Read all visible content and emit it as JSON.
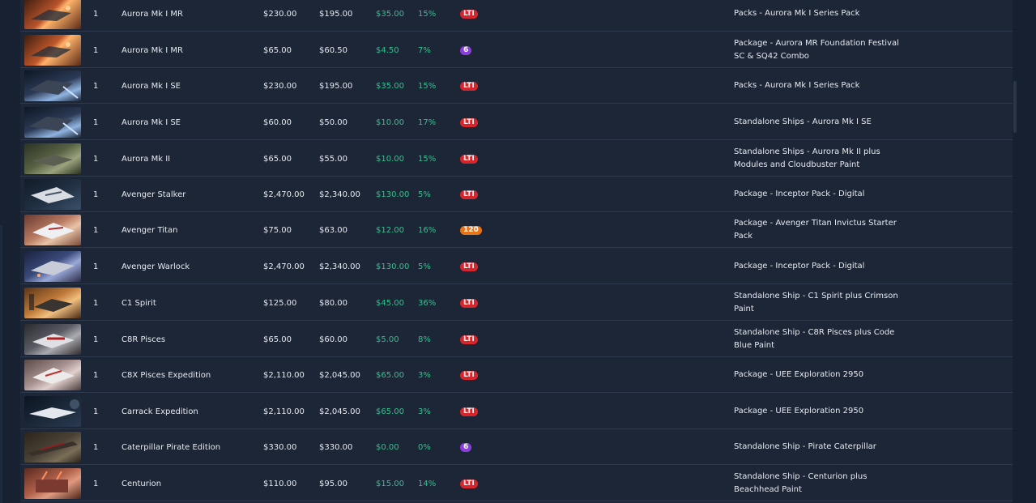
{
  "colors": {
    "background": "#172030",
    "panel": "#1d2636",
    "divider": "#2d3a4e",
    "savings_green": "#2fc28e",
    "badge_lti": "#d6262d",
    "badge_6": "#8a3fd8",
    "badge_120": "#e8741a"
  },
  "rows": [
    {
      "qty": "1",
      "name": "Aurora Mk I MR",
      "price": "$230.00",
      "paid": "$195.00",
      "savings": "$35.00",
      "percent": "15%",
      "insurance": "LTI",
      "package": "Packs - Aurora Mk I Series Pack",
      "thumb": "aurora-mr"
    },
    {
      "qty": "1",
      "name": "Aurora Mk I MR",
      "price": "$65.00",
      "paid": "$60.50",
      "savings": "$4.50",
      "percent": "7%",
      "insurance": "6",
      "package": "Package - Aurora MR Foundation Festival SC & SQ42 Combo",
      "thumb": "aurora-mr"
    },
    {
      "qty": "1",
      "name": "Aurora Mk I SE",
      "price": "$230.00",
      "paid": "$195.00",
      "savings": "$35.00",
      "percent": "15%",
      "insurance": "LTI",
      "package": "Packs - Aurora Mk I Series Pack",
      "thumb": "aurora-se"
    },
    {
      "qty": "1",
      "name": "Aurora Mk I SE",
      "price": "$60.00",
      "paid": "$50.00",
      "savings": "$10.00",
      "percent": "17%",
      "insurance": "LTI",
      "package": "Standalone Ships - Aurora Mk I SE",
      "thumb": "aurora-se"
    },
    {
      "qty": "1",
      "name": "Aurora Mk II",
      "price": "$65.00",
      "paid": "$55.00",
      "savings": "$10.00",
      "percent": "15%",
      "insurance": "LTI",
      "package": "Standalone Ships - Aurora Mk II plus Modules and Cloudbuster Paint",
      "thumb": "aurora-mk2"
    },
    {
      "qty": "1",
      "name": "Avenger Stalker",
      "price": "$2,470.00",
      "paid": "$2,340.00",
      "savings": "$130.00",
      "percent": "5%",
      "insurance": "LTI",
      "package": "Package - Inceptor Pack - Digital",
      "thumb": "avenger-stalker"
    },
    {
      "qty": "1",
      "name": "Avenger Titan",
      "price": "$75.00",
      "paid": "$63.00",
      "savings": "$12.00",
      "percent": "16%",
      "insurance": "120",
      "package": "Package - Avenger Titan Invictus Starter Pack",
      "thumb": "avenger-titan"
    },
    {
      "qty": "1",
      "name": "Avenger Warlock",
      "price": "$2,470.00",
      "paid": "$2,340.00",
      "savings": "$130.00",
      "percent": "5%",
      "insurance": "LTI",
      "package": "Package - Inceptor Pack - Digital",
      "thumb": "avenger-warlock"
    },
    {
      "qty": "1",
      "name": "C1 Spirit",
      "price": "$125.00",
      "paid": "$80.00",
      "savings": "$45.00",
      "percent": "36%",
      "insurance": "LTI",
      "package": "Standalone Ship - C1 Spirit plus Crimson Paint",
      "thumb": "c1-spirit"
    },
    {
      "qty": "1",
      "name": "C8R Pisces",
      "price": "$65.00",
      "paid": "$60.00",
      "savings": "$5.00",
      "percent": "8%",
      "insurance": "LTI",
      "package": "Standalone Ship - C8R Pisces plus Code Blue Paint",
      "thumb": "c8r-pisces"
    },
    {
      "qty": "1",
      "name": "C8X Pisces Expedition",
      "price": "$2,110.00",
      "paid": "$2,045.00",
      "savings": "$65.00",
      "percent": "3%",
      "insurance": "LTI",
      "package": "Package - UEE Exploration 2950",
      "thumb": "c8x-pisces"
    },
    {
      "qty": "1",
      "name": "Carrack Expedition",
      "price": "$2,110.00",
      "paid": "$2,045.00",
      "savings": "$65.00",
      "percent": "3%",
      "insurance": "LTI",
      "package": "Package - UEE Exploration 2950",
      "thumb": "carrack"
    },
    {
      "qty": "1",
      "name": "Caterpillar Pirate Edition",
      "price": "$330.00",
      "paid": "$330.00",
      "savings": "$0.00",
      "percent": "0%",
      "insurance": "6",
      "package": "Standalone Ship - Pirate Caterpillar",
      "thumb": "caterpillar"
    },
    {
      "qty": "1",
      "name": "Centurion",
      "price": "$110.00",
      "paid": "$95.00",
      "savings": "$15.00",
      "percent": "14%",
      "insurance": "LTI",
      "package": "Standalone Ship - Centurion plus Beachhead Paint",
      "thumb": "centurion"
    }
  ]
}
